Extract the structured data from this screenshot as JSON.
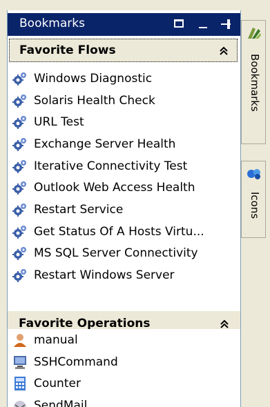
{
  "panel": {
    "title": "Bookmarks"
  },
  "sections": [
    {
      "title": "Favorite Flows",
      "items": [
        {
          "label": "Windows Diagnostic",
          "icon": "flow-gear-icon"
        },
        {
          "label": "Solaris Health Check",
          "icon": "flow-gear-icon"
        },
        {
          "label": "URL Test",
          "icon": "flow-gear-icon"
        },
        {
          "label": "Exchange Server Health",
          "icon": "flow-gear-icon"
        },
        {
          "label": "Iterative Connectivity Test",
          "icon": "flow-gear-icon"
        },
        {
          "label": "Outlook Web Access Health",
          "icon": "flow-gear-icon"
        },
        {
          "label": "Restart Service",
          "icon": "flow-gear-icon"
        },
        {
          "label": "Get Status Of A Hosts Virtu...",
          "icon": "flow-gear-icon"
        },
        {
          "label": "MS SQL Server Connectivity",
          "icon": "flow-gear-icon"
        },
        {
          "label": "Restart Windows Server",
          "icon": "flow-gear-icon"
        }
      ]
    },
    {
      "title": "Favorite Operations",
      "items": [
        {
          "label": "manual",
          "icon": "user-icon"
        },
        {
          "label": "SSHCommand",
          "icon": "computer-icon"
        },
        {
          "label": "Counter",
          "icon": "calculator-icon"
        },
        {
          "label": "SendMail",
          "icon": "mail-icon"
        }
      ]
    }
  ],
  "side_tabs": [
    {
      "label": "Bookmarks",
      "icon": "bookmarks-tab-icon"
    },
    {
      "label": "Icons",
      "icon": "icons-tab-icon"
    }
  ],
  "colors": {
    "titlebar": "#0a246a",
    "panel_bg": "#ffffff",
    "chrome_bg": "#ece9d8"
  }
}
